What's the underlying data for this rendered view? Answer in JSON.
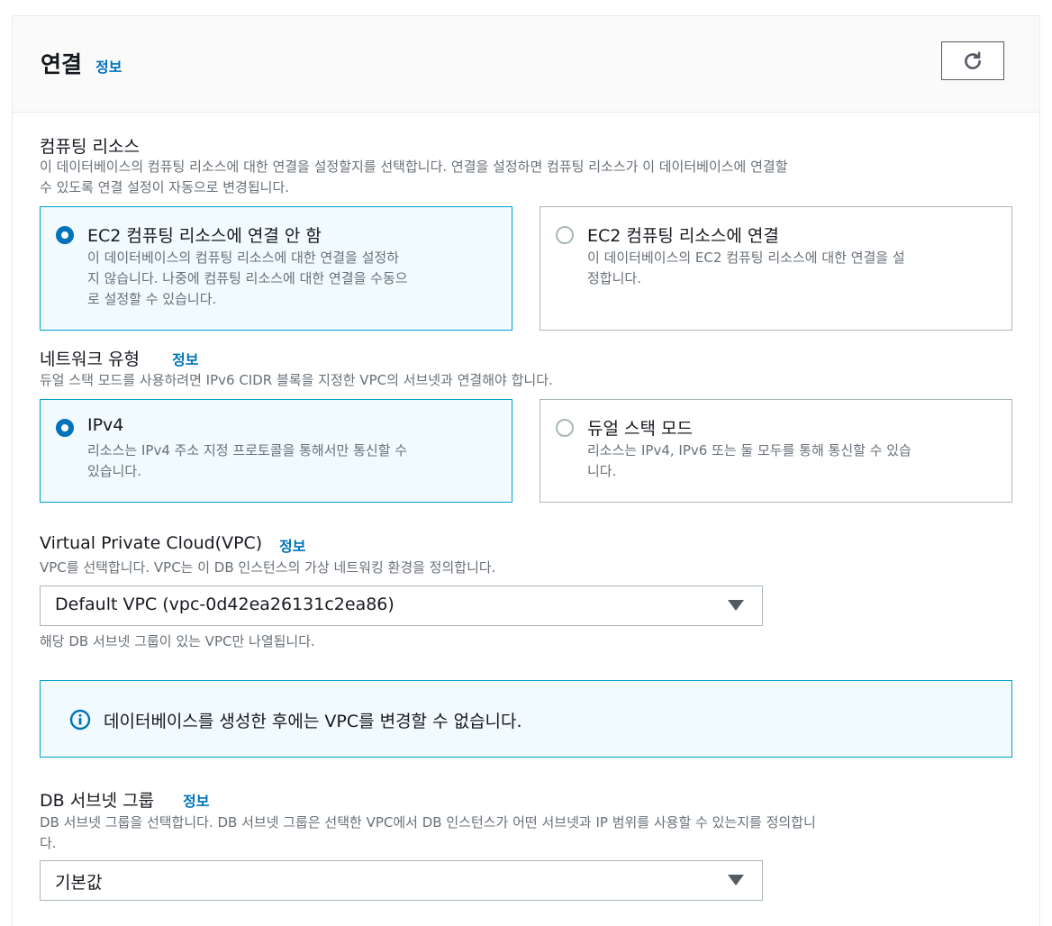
{
  "header": {
    "title": "연결",
    "info": "정보",
    "refresh_icon": "refresh-icon"
  },
  "compute": {
    "label": "컴퓨팅 리소스",
    "desc_line1": "이 데이터베이스의 컴퓨팅 리소스에 대한 연결을 설정할지를 선택합니다. 연결을 설정하면 컴퓨팅 리소스가 이 데이터베이스에 연결할",
    "desc_line2": "수 있도록 연결 설정이 자동으로 변경됩니다.",
    "options": [
      {
        "title": "EC2 컴퓨팅 리소스에 연결 안 함",
        "desc_lines": [
          "이 데이터베이스의 컴퓨팅 리소스에 대한 연결을 설정하",
          "지 않습니다. 나중에 컴퓨팅 리소스에 대한 연결을 수동으",
          "로 설정할 수 있습니다."
        ],
        "selected": true
      },
      {
        "title": "EC2 컴퓨팅 리소스에 연결",
        "desc_lines": [
          "이 데이터베이스의 EC2 컴퓨팅 리소스에 대한 연결을 설",
          "정합니다."
        ],
        "selected": false
      }
    ]
  },
  "network": {
    "label": "네트워크 유형",
    "info": "정보",
    "desc": "듀얼 스택 모드를 사용하려면 IPv6 CIDR 블록을 지정한 VPC의 서브넷과 연결해야 합니다.",
    "options": [
      {
        "title": "IPv4",
        "desc_lines": [
          "리소스는 IPv4 주소 지정 프로토콜을 통해서만 통신할 수",
          "있습니다."
        ],
        "selected": true
      },
      {
        "title": "듀얼 스택 모드",
        "desc_lines": [
          "리소스는 IPv4, IPv6 또는 둘 모두를 통해 통신할 수 있습",
          "니다."
        ],
        "selected": false
      }
    ]
  },
  "vpc": {
    "label": "Virtual Private Cloud(VPC)",
    "info": "정보",
    "desc": "VPC를 선택합니다. VPC는 이 DB 인스턴스의 가상 네트워킹 환경을 정의합니다.",
    "value": "Default VPC (vpc-0d42ea26131c2ea86)",
    "hint": "해당 DB 서브넷 그룹이 있는 VPC만 나열됩니다."
  },
  "alert": {
    "text": "데이터베이스를 생성한 후에는 VPC를 변경할 수 없습니다.",
    "icon": "info-circle-icon"
  },
  "subnet": {
    "label": "DB 서브넷 그룹",
    "info": "정보",
    "desc_line1": "DB 서브넷 그룹을 선택합니다. DB 서브넷 그룹은 선택한 VPC에서 DB 인스턴스가 어떤 서브넷과 IP 범위를 사용할 수 있는지를 정의합니",
    "desc_line2": "다.",
    "value": "기본값"
  },
  "colors": {
    "link": "#0073bb",
    "selected_border": "#00a1c9",
    "selected_bg": "#f1faff"
  }
}
